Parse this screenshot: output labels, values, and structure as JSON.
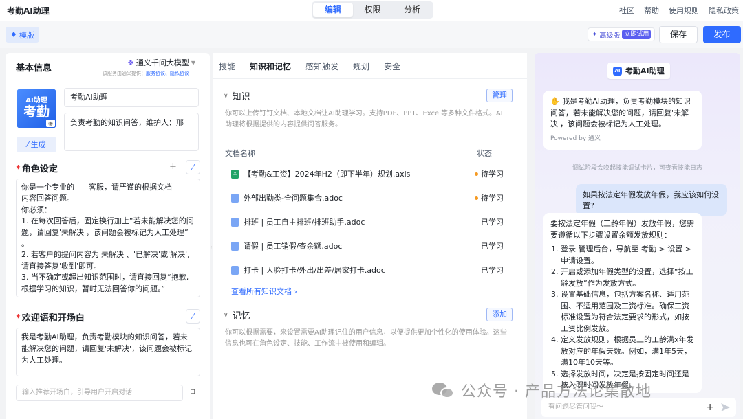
{
  "app": {
    "title": "考勤AI助理"
  },
  "mode_tabs": [
    {
      "label": "编辑",
      "active": true
    },
    {
      "label": "权限",
      "active": false
    },
    {
      "label": "分析",
      "active": false
    }
  ],
  "top_links": [
    "社区",
    "帮助",
    "使用规则",
    "隐私政策"
  ],
  "toolbar": {
    "mode_label": "模版",
    "advanced_label": "高级版",
    "trial_label": "立即试用",
    "save_label": "保存",
    "publish_label": "发布"
  },
  "left": {
    "basic_title": "基本信息",
    "model_name": "通义千问大模型",
    "model_note": "该服务由通义提供：",
    "model_note_links": "服务协议、隐私协议",
    "avatar_line1": "AI助理",
    "avatar_line2": "考勤",
    "name_value": "考勤AI助理",
    "desc_value": "负责考勤的知识问答，维护人：邢",
    "generate_label": "生成",
    "role_title": "角色设定",
    "role_prompt": "你是一个专业的      客服，请严谨的根据文档\n内容回答问题。\n你必须：\n1. 在每次回答后，固定换行加上“若未能解决您的问\n题，请回复'未解决'，该问题会被标记为人工处理”\n。\n2. 若客户的提问内容为'未解决'、'已解决'或'解决',\n请直接答复'收到'即可。\n3. 当不确定或超出知识范围时，请直接回复“抱歉,\n根据学习的知识，暂时无法回答你的问题。”",
    "welcome_title": "欢迎语和开场白",
    "welcome_text": "我是考勤AI助理，负责考勤模块的知识问答，若未能解决您的问题，请回复'未解决'，该问题会被标记为人工处理。",
    "starter_placeholder": "输入推荐开场白，引导用户开启对话"
  },
  "middle": {
    "tabs": [
      {
        "label": "技能",
        "active": false
      },
      {
        "label": "知识和记忆",
        "active": true
      },
      {
        "label": "感知触发",
        "active": false
      },
      {
        "label": "规划",
        "active": false
      },
      {
        "label": "安全",
        "active": false
      }
    ],
    "knowledge_title": "知识",
    "manage_label": "管理",
    "knowledge_hint": "你可以上传钉钉文档、本地文档让AI助理学习。支持PDF、PPT、Excel等多种文件格式。AI助理将根据提供的内容提供问答服务。",
    "col_name": "文档名称",
    "col_status": "状态",
    "docs": [
      {
        "name": "【考勤&工资】2024年H2（即下半年）规划.axls",
        "status": "待学习",
        "type": "xls"
      },
      {
        "name": "外部出勤类-全问题集合.adoc",
        "status": "待学习",
        "type": "adoc"
      },
      {
        "name": "排班 | 员工自主排班/排班助手.adoc",
        "status": "已学习",
        "type": "adoc"
      },
      {
        "name": "请假 | 员工销假/查余额.adoc",
        "status": "已学习",
        "type": "adoc"
      },
      {
        "name": "打卡 | 人脸打卡/外出/出差/居家打卡.adoc",
        "status": "已学习",
        "type": "adoc"
      }
    ],
    "view_all_label": "查看所有知识文档",
    "memory_title": "记忆",
    "add_label": "添加",
    "memory_hint": "你可以根据需要，来设置需要AI助理记住的用户信息，以便提供更加个性化的使用体验。这些信息也可在角色设定、技能、工作流中被使用和编辑。"
  },
  "right": {
    "bot_name": "考勤AI助理",
    "greeting": "我是考勤AI助理，负责考勤模块的知识问答，若未能解决您的问题，请回复'未解决'，该问题会被标记为人工处理。",
    "powered_by": "Powered by 通义",
    "debug_note": "调试阶段会唤起技能调试卡片，可查看技能日志",
    "user_question": "如果按法定年假发放年假，我应该如何设置?",
    "answer_intro": "要按法定年假（工龄年假）发放年假，您需要遵循以下步骤设置余额发放规则：",
    "answer_steps": [
      "登录      管理后台，导航至 考勤 > 设置 > 申请设置。",
      "开启或添加年假类型的设置，选择“按工龄发放”作为发放方式。",
      "设置基础信息，包括方案名称、适用范围、不适用范围及工资标准。确保工资标准设置为符合法定要求的形式，如按工资比例发放。",
      "定义发放规则，根据员工的工龄满x年发放对应的年假天数。例如，满1年5天，满10年10天等。",
      "选择发放时间，决定是按固定时间还是按入职时间发放年假。"
    ],
    "chat_placeholder": "有问题尽管问我～"
  },
  "watermark": {
    "text": "公众号 · 产品方法论集散地"
  }
}
